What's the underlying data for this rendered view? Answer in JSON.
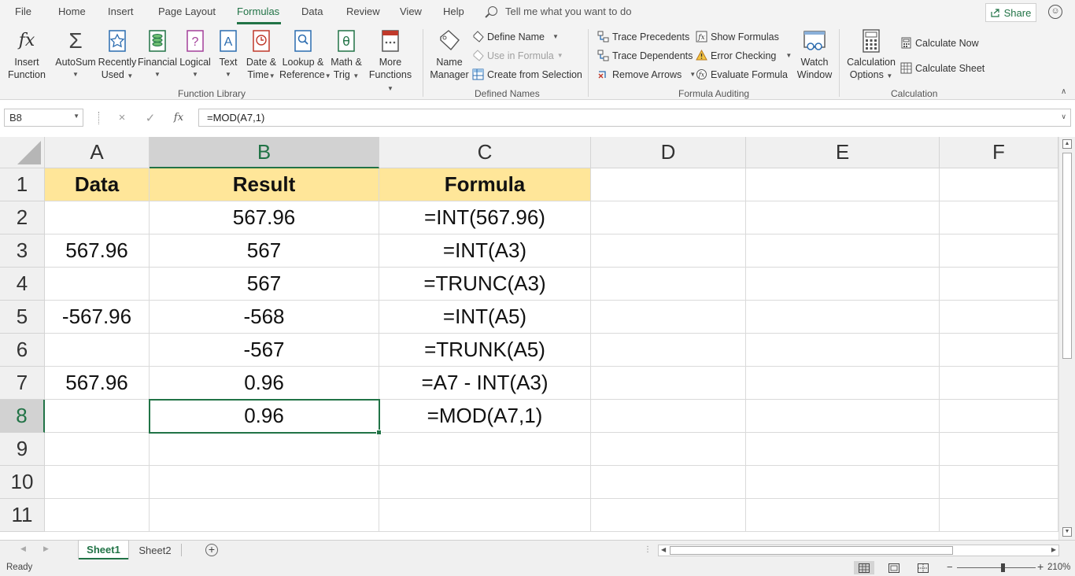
{
  "menu": {
    "tabs": [
      "File",
      "Home",
      "Insert",
      "Page Layout",
      "Formulas",
      "Data",
      "Review",
      "View",
      "Help"
    ],
    "active": "Formulas",
    "tellme": "Tell me what you want to do",
    "share": "Share"
  },
  "ribbon": {
    "insert_function": [
      "Insert",
      "Function"
    ],
    "autosum": "AutoSum",
    "recently_used": [
      "Recently",
      "Used"
    ],
    "financial": "Financial",
    "logical": "Logical",
    "text": "Text",
    "date_time": [
      "Date &",
      "Time"
    ],
    "lookup_reference": [
      "Lookup &",
      "Reference"
    ],
    "math_trig": [
      "Math &",
      "Trig"
    ],
    "more_functions": [
      "More",
      "Functions"
    ],
    "function_library_label": "Function Library",
    "name_manager": [
      "Name",
      "Manager"
    ],
    "define_name": "Define Name",
    "use_in_formula": "Use in Formula",
    "create_from_selection": "Create from Selection",
    "defined_names_label": "Defined Names",
    "trace_precedents": "Trace Precedents",
    "trace_dependents": "Trace Dependents",
    "remove_arrows": "Remove Arrows",
    "show_formulas": "Show Formulas",
    "error_checking": "Error Checking",
    "evaluate_formula": "Evaluate Formula",
    "watch_window": [
      "Watch",
      "Window"
    ],
    "formula_auditing_label": "Formula Auditing",
    "calculation_options": [
      "Calculation",
      "Options"
    ],
    "calculate_now": "Calculate Now",
    "calculate_sheet": "Calculate Sheet",
    "calculation_label": "Calculation"
  },
  "formula_bar": {
    "name_box": "B8",
    "formula": "=MOD(A7,1)",
    "cancel_icon": "×",
    "enter_icon": "✓",
    "fx_icon": "fx"
  },
  "columns": [
    "A",
    "B",
    "C",
    "D",
    "E",
    "F"
  ],
  "selected_column": "B",
  "rows": [
    "1",
    "2",
    "3",
    "4",
    "5",
    "6",
    "7",
    "8",
    "9",
    "10",
    "11"
  ],
  "selected_row": "8",
  "cells": [
    [
      "Data",
      "Result",
      "Formula"
    ],
    [
      "",
      "567.96",
      "=INT(567.96)"
    ],
    [
      "567.96",
      "567",
      "=INT(A3)"
    ],
    [
      "",
      "567",
      "=TRUNC(A3)"
    ],
    [
      "-567.96",
      "-568",
      "=INT(A5)"
    ],
    [
      "",
      "-567",
      "=TRUNK(A5)"
    ],
    [
      "567.96",
      "0.96",
      "=A7 - INT(A3)"
    ],
    [
      "",
      "0.96",
      "=MOD(A7,1)"
    ]
  ],
  "sheets": [
    "Sheet1",
    "Sheet2"
  ],
  "active_sheet": "Sheet1",
  "status": {
    "text": "Ready",
    "zoom": "210%",
    "zoom_fraction": 0.58
  },
  "colors": {
    "accent": "#217346",
    "header_fill": "#ffe699"
  }
}
